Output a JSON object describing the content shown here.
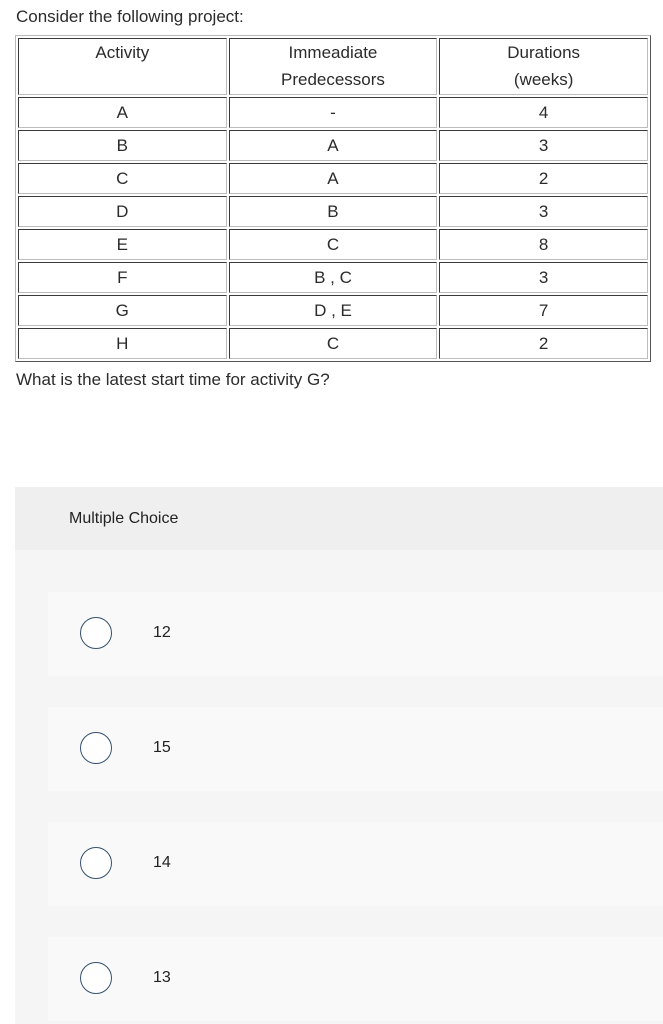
{
  "intro_text": "Consider the following project:",
  "table": {
    "headers": [
      {
        "line1": "Activity",
        "line2": ""
      },
      {
        "line1": "Immeadiate",
        "line2": "Predecessors"
      },
      {
        "line1": "Durations",
        "line2": "(weeks)"
      }
    ],
    "rows": [
      {
        "activity": "A",
        "predecessors": "-",
        "duration": "4"
      },
      {
        "activity": "B",
        "predecessors": "A",
        "duration": "3"
      },
      {
        "activity": "C",
        "predecessors": "A",
        "duration": "2"
      },
      {
        "activity": "D",
        "predecessors": "B",
        "duration": "3"
      },
      {
        "activity": "E",
        "predecessors": "C",
        "duration": "8"
      },
      {
        "activity": "F",
        "predecessors": "B , C",
        "duration": "3"
      },
      {
        "activity": "G",
        "predecessors": "D , E",
        "duration": "7"
      },
      {
        "activity": "H",
        "predecessors": "C",
        "duration": "2"
      }
    ]
  },
  "question": "What is the latest start time for activity G?",
  "multiple_choice": {
    "header": "Multiple Choice",
    "options": [
      {
        "label": "12",
        "selected": false,
        "icon": "radio-unchecked-icon"
      },
      {
        "label": "15",
        "selected": false,
        "icon": "radio-unchecked-icon"
      },
      {
        "label": "14",
        "selected": false,
        "icon": "radio-unchecked-icon"
      },
      {
        "label": "13",
        "selected": false,
        "icon": "radio-unchecked-icon"
      }
    ]
  },
  "colors": {
    "radio_border": "#34506e",
    "panel_header_bg": "#efefef",
    "panel_bg": "#f5f5f5",
    "option_bg": "#f9f9f9",
    "text": "#2b2b2b"
  }
}
